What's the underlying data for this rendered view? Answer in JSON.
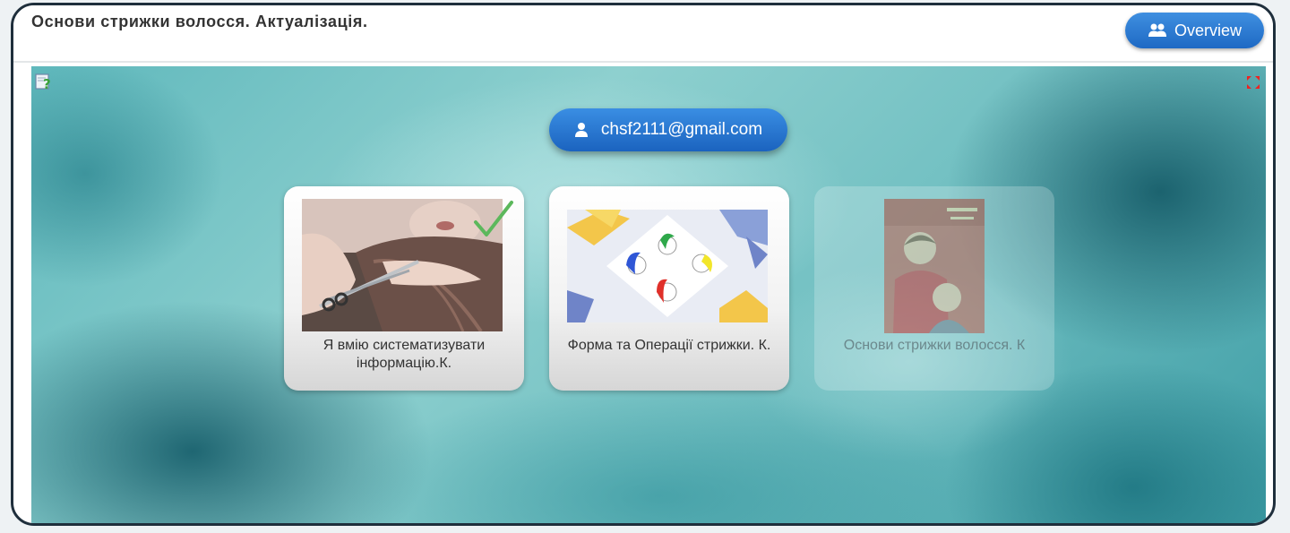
{
  "header": {
    "title": "Основи стрижки волосся. Актуалізація.",
    "overview_label": "Overview"
  },
  "user": {
    "email": "chsf2111@gmail.com"
  },
  "cards": [
    {
      "label": "Я вмію систематизувати інформацію.К.",
      "completed": true,
      "active": true
    },
    {
      "label": "Форма та Операції стрижки. К.",
      "completed": false,
      "active": true
    },
    {
      "label": "Основи стрижки волосся. К",
      "completed": false,
      "active": false
    }
  ],
  "icons": {
    "help": "help-icon",
    "fullscreen": "fullscreen-icon",
    "overview": "users-icon",
    "user": "user-icon",
    "check": "check-icon"
  },
  "colors": {
    "accent": "#1e69c4",
    "check": "#4caf50"
  }
}
